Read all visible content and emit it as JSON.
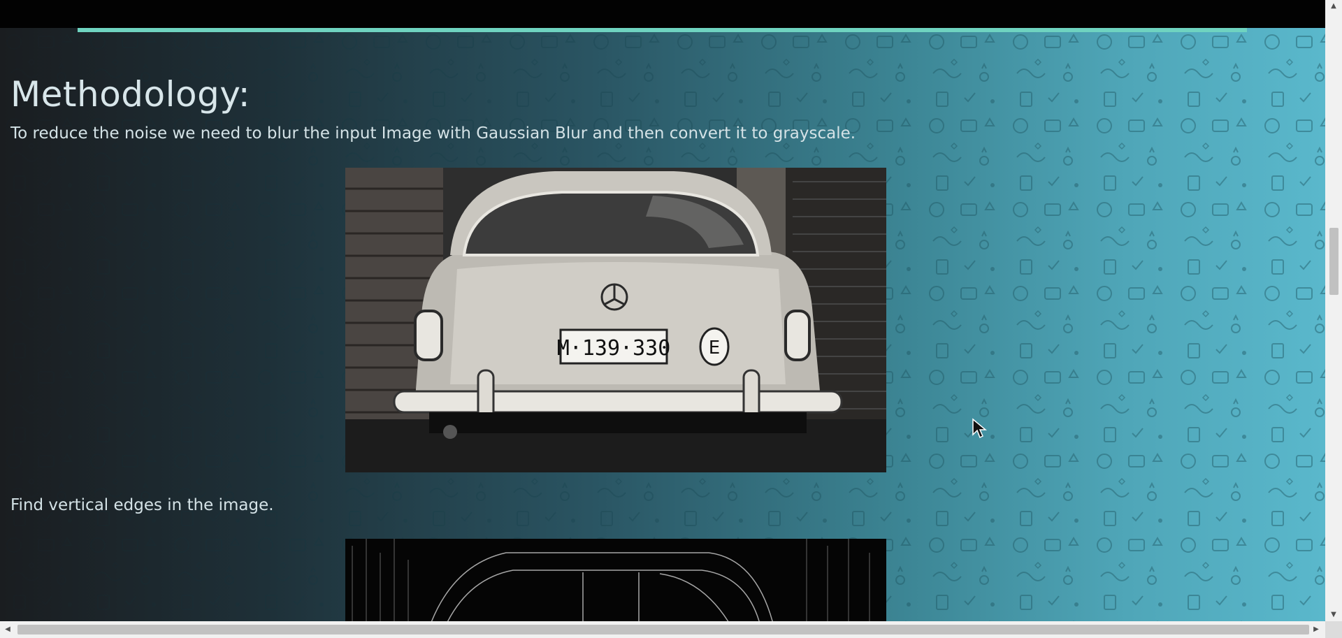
{
  "section": {
    "title": "Methodology:"
  },
  "paragraphs": [
    "To reduce the noise we need to blur the input Image with Gaussian Blur and then convert it to grayscale.",
    "Find vertical edges in the image."
  ],
  "figures": [
    {
      "kind": "photo",
      "tone": "grayscale",
      "plate_text": "M·139·330",
      "badge_text": "E"
    },
    {
      "kind": "photo",
      "tone": "edge-map"
    }
  ],
  "colors": {
    "accent_line": "#6fd3c0",
    "top_bar": "#020202",
    "gradient_start": "#1a1d20",
    "gradient_end": "#5ab8cc",
    "text": "#d4e2e6"
  },
  "scrollbars": {
    "up_arrow": "▲",
    "down_arrow": "▼",
    "left_arrow": "◀",
    "right_arrow": "▶"
  },
  "icons": {
    "cursor": "mouse-pointer-icon"
  }
}
